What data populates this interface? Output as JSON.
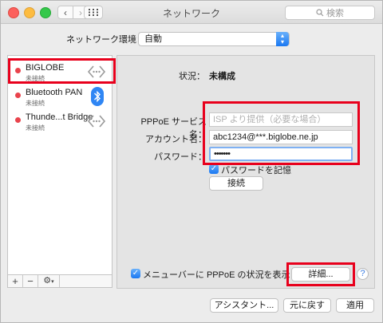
{
  "window": {
    "title": "ネットワーク",
    "search_placeholder": "検索"
  },
  "nav": {
    "back": "‹",
    "forward": "›"
  },
  "location": {
    "label": "ネットワーク環境：",
    "value": "自動"
  },
  "sidebar": {
    "services": [
      {
        "name": "BIGLOBE",
        "status": "未接続",
        "icon": "ethernet-icon"
      },
      {
        "name": "Bluetooth PAN",
        "status": "未接続",
        "icon": "bluetooth-icon"
      },
      {
        "name": "Thunde...t Bridge",
        "status": "未接続",
        "icon": "ethernet-icon"
      }
    ],
    "add": "+",
    "remove": "−",
    "gear": "⚙"
  },
  "detail": {
    "status_label": "状況：",
    "status_value": "未構成",
    "service_name_label": "PPPoE サービス名：",
    "service_name_placeholder": "ISP より提供（必要な場合）",
    "account_label": "アカウント名：",
    "account_value": "abc1234@***.biglobe.ne.jp",
    "password_label": "パスワード：",
    "password_value": "•••••••",
    "remember_password": "パスワードを記憶",
    "connect_button": "接続",
    "show_in_menubar": "メニューバーに PPPoE の状況を表示",
    "advanced_button": "詳細...",
    "help": "?"
  },
  "footer": {
    "assistant": "アシスタント...",
    "revert": "元に戻す",
    "apply": "適用"
  },
  "colors": {
    "highlight_red": "#e8001c",
    "status_red": "#e9434c",
    "accent_blue": "#1a78f2"
  }
}
